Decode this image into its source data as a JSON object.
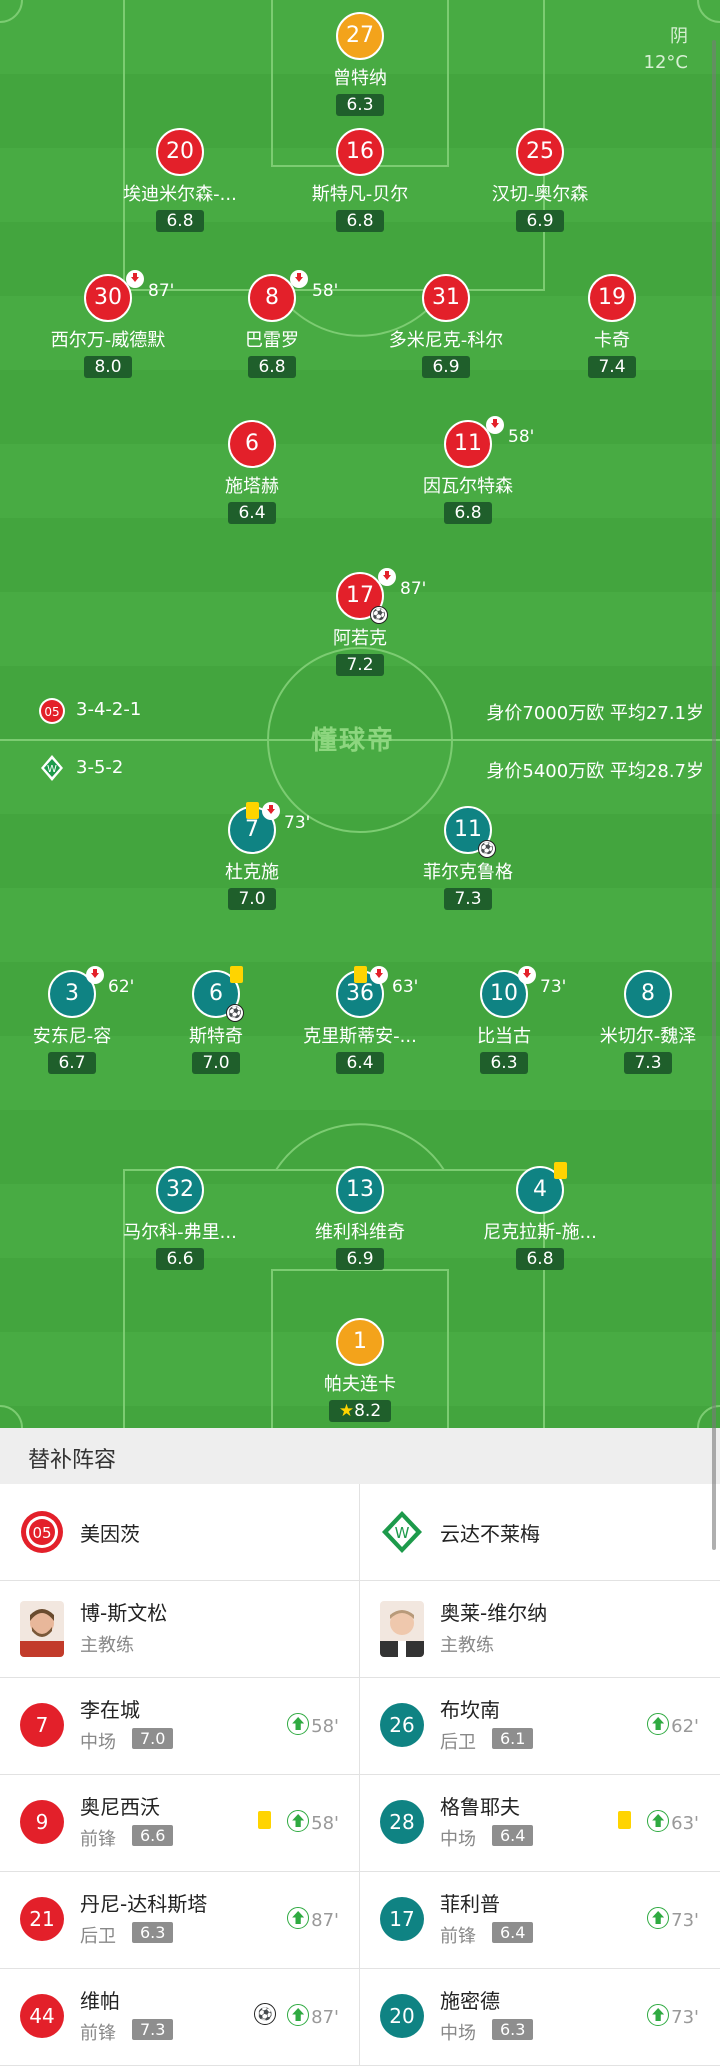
{
  "weather": {
    "condition": "阴",
    "temp": "12°C"
  },
  "watermark": "懂球帝",
  "home": {
    "formation": "3-4-2-1",
    "value_text": "身价7000万欧 平均27.1岁"
  },
  "away": {
    "formation": "3-5-2",
    "value_text": "身价5400万欧 平均28.7岁"
  },
  "home_players": [
    {
      "num": "27",
      "name": "曾特纳",
      "rating": "6.3"
    },
    {
      "num": "20",
      "name": "埃迪米尔森-...",
      "rating": "6.8"
    },
    {
      "num": "16",
      "name": "斯特凡-贝尔",
      "rating": "6.8"
    },
    {
      "num": "25",
      "name": "汉切-奥尔森",
      "rating": "6.9"
    },
    {
      "num": "30",
      "name": "西尔万-威德默",
      "rating": "8.0",
      "sub_time": "87'"
    },
    {
      "num": "8",
      "name": "巴雷罗",
      "rating": "6.8",
      "sub_time": "58'"
    },
    {
      "num": "31",
      "name": "多米尼克-科尔",
      "rating": "6.9"
    },
    {
      "num": "19",
      "name": "卡奇",
      "rating": "7.4"
    },
    {
      "num": "6",
      "name": "施塔赫",
      "rating": "6.4"
    },
    {
      "num": "11",
      "name": "因瓦尔特森",
      "rating": "6.8",
      "sub_time": "58'"
    },
    {
      "num": "17",
      "name": "阿若克",
      "rating": "7.2",
      "sub_time": "87'"
    }
  ],
  "away_players": [
    {
      "num": "7",
      "name": "杜克施",
      "rating": "7.0",
      "sub_time": "73'"
    },
    {
      "num": "11",
      "name": "菲尔克鲁格",
      "rating": "7.3"
    },
    {
      "num": "3",
      "name": "安东尼-容",
      "rating": "6.7",
      "sub_time": "62'"
    },
    {
      "num": "6",
      "name": "斯特奇",
      "rating": "7.0"
    },
    {
      "num": "36",
      "name": "克里斯蒂安-...",
      "rating": "6.4",
      "sub_time": "63'"
    },
    {
      "num": "10",
      "name": "比当古",
      "rating": "6.3",
      "sub_time": "73'"
    },
    {
      "num": "8",
      "name": "米切尔-魏泽",
      "rating": "7.3"
    },
    {
      "num": "32",
      "name": "马尔科-弗里...",
      "rating": "6.6"
    },
    {
      "num": "13",
      "name": "维利科维奇",
      "rating": "6.9"
    },
    {
      "num": "4",
      "name": "尼克拉斯-施...",
      "rating": "6.8"
    },
    {
      "num": "1",
      "name": "帕夫连卡",
      "rating": "8.2"
    }
  ],
  "subs": {
    "title": "替补阵容",
    "home_team": "美因茨",
    "away_team": "云达不莱梅",
    "home_coach": {
      "name": "博-斯文松",
      "role": "主教练"
    },
    "away_coach": {
      "name": "奥莱-维尔纳",
      "role": "主教练"
    },
    "rows": [
      {
        "home": {
          "num": "7",
          "name": "李在城",
          "pos": "中场",
          "rating": "7.0",
          "in": "58'"
        },
        "away": {
          "num": "26",
          "name": "布坎南",
          "pos": "后卫",
          "rating": "6.1",
          "in": "62'"
        }
      },
      {
        "home": {
          "num": "9",
          "name": "奥尼西沃",
          "pos": "前锋",
          "rating": "6.6",
          "in": "58'"
        },
        "away": {
          "num": "28",
          "name": "格鲁耶夫",
          "pos": "中场",
          "rating": "6.4",
          "in": "63'"
        }
      },
      {
        "home": {
          "num": "21",
          "name": "丹尼-达科斯塔",
          "pos": "后卫",
          "rating": "6.3",
          "in": "87'"
        },
        "away": {
          "num": "17",
          "name": "菲利普",
          "pos": "前锋",
          "rating": "6.4",
          "in": "73'"
        }
      },
      {
        "home": {
          "num": "44",
          "name": "维帕",
          "pos": "前锋",
          "rating": "7.3",
          "in": "87'"
        },
        "away": {
          "num": "20",
          "name": "施密德",
          "pos": "中场",
          "rating": "6.3",
          "in": "73'"
        }
      }
    ]
  }
}
